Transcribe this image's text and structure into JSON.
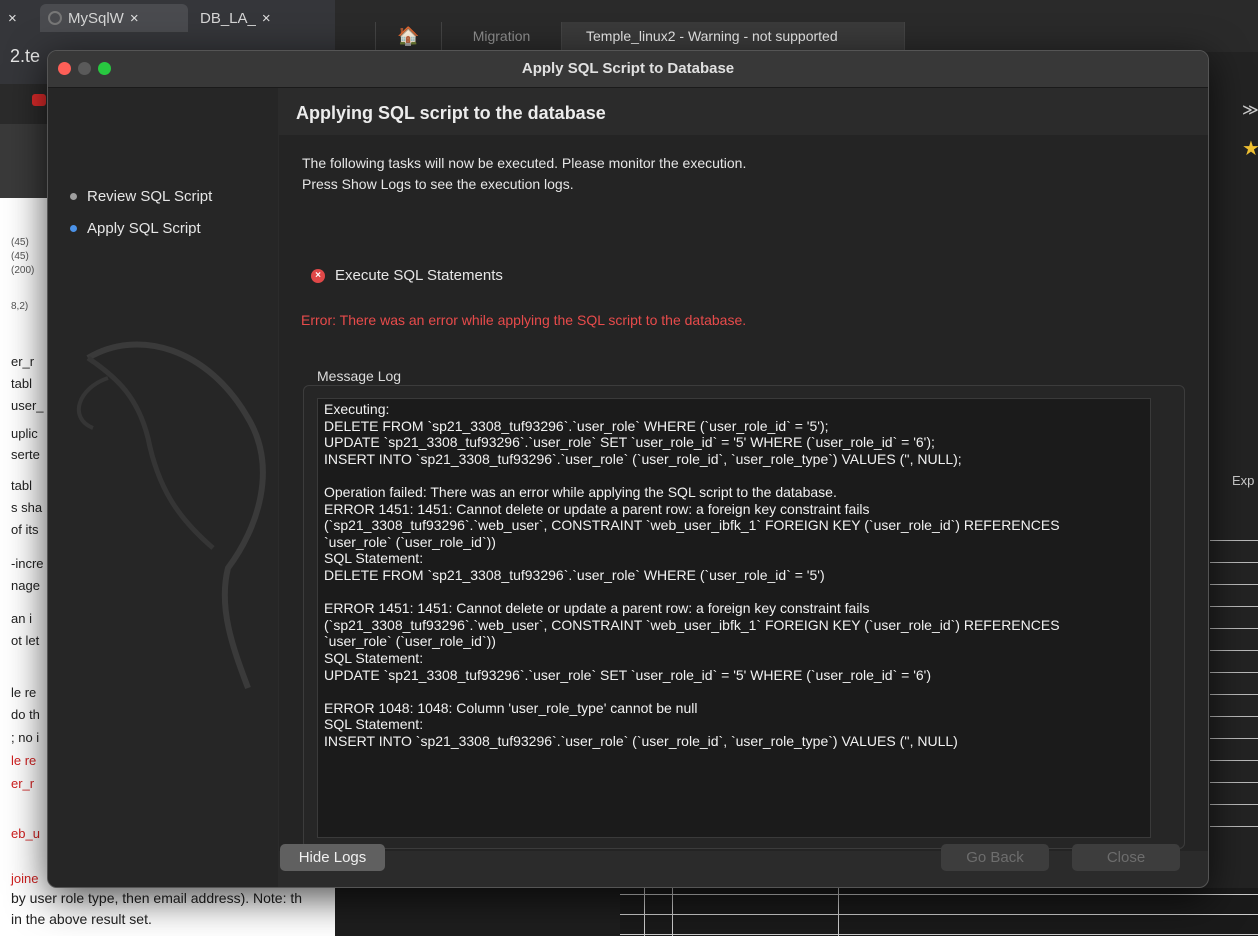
{
  "browser": {
    "tabs": [
      {
        "label": "",
        "close": "×"
      },
      {
        "label": "MySqlW",
        "close": "×"
      },
      {
        "label": "DB_LA_",
        "close": "×"
      }
    ],
    "address_fragment": "2.te"
  },
  "document": {
    "col_types": [
      "(45)",
      "(45)",
      "(200)",
      "8,2)"
    ],
    "lines": [
      {
        "text": "er_r",
        "red": false
      },
      {
        "text": " tabl",
        "red": false
      },
      {
        "text": "user_",
        "red": false
      },
      {
        "text": "uplic",
        "red": false
      },
      {
        "text": "serte",
        "red": false
      },
      {
        "text": " tabl",
        "red": false
      },
      {
        "text": "s sha",
        "red": false
      },
      {
        "text": "of its",
        "red": false
      },
      {
        "text": "-incre",
        "red": false
      },
      {
        "text": "nage",
        "red": false
      },
      {
        "text": " an i",
        "red": false
      },
      {
        "text": "ot let",
        "red": false
      },
      {
        "text": "le re",
        "red": false
      },
      {
        "text": "do th",
        "red": false
      },
      {
        "text": "; no i",
        "red": false
      },
      {
        "text": "le re",
        "red": true
      },
      {
        "text": "er_r",
        "red": true
      },
      {
        "text": "eb_u",
        "red": true
      },
      {
        "text": "joine",
        "red": true
      }
    ],
    "bottom_lines": [
      "by user role type, then email address).  Note: th",
      " in the above result set."
    ]
  },
  "workbench": {
    "tabs": [
      {
        "label": "🏠"
      },
      {
        "label": "Migration"
      },
      {
        "label": "Temple_linux2 - Warning - not supported"
      }
    ],
    "overflow": "≫",
    "star": "★",
    "export_fragment": "Exp"
  },
  "dialog": {
    "title": "Apply SQL Script to Database",
    "steps": [
      {
        "label": "Review SQL Script",
        "current": false
      },
      {
        "label": "Apply SQL Script",
        "current": true
      }
    ],
    "heading": "Applying SQL script to the database",
    "description": [
      "The following tasks will now be executed. Please monitor the execution.",
      "Press Show Logs to see the execution logs."
    ],
    "task": {
      "label": "Execute SQL Statements",
      "icon": "×",
      "status": "error"
    },
    "error_message": "Error: There was an error while applying the SQL script to the database.",
    "log_label": "Message Log",
    "log_lines": [
      "Executing:",
      "DELETE FROM `sp21_3308_tuf93296`.`user_role` WHERE (`user_role_id` = '5');",
      "UPDATE `sp21_3308_tuf93296`.`user_role` SET `user_role_id` = '5' WHERE (`user_role_id` = '6');",
      "INSERT INTO `sp21_3308_tuf93296`.`user_role` (`user_role_id`, `user_role_type`) VALUES ('', NULL);",
      "",
      "Operation failed: There was an error while applying the SQL script to the database.",
      "ERROR 1451: 1451: Cannot delete or update a parent row: a foreign key constraint fails",
      "(`sp21_3308_tuf93296`.`web_user`, CONSTRAINT `web_user_ibfk_1` FOREIGN KEY (`user_role_id`) REFERENCES",
      "`user_role` (`user_role_id`))",
      "SQL Statement:",
      "DELETE FROM `sp21_3308_tuf93296`.`user_role` WHERE (`user_role_id` = '5')",
      "",
      "ERROR 1451: 1451: Cannot delete or update a parent row: a foreign key constraint fails",
      "(`sp21_3308_tuf93296`.`web_user`, CONSTRAINT `web_user_ibfk_1` FOREIGN KEY (`user_role_id`) REFERENCES",
      "`user_role` (`user_role_id`))",
      "SQL Statement:",
      "UPDATE `sp21_3308_tuf93296`.`user_role` SET `user_role_id` = '5' WHERE (`user_role_id` = '6')",
      "",
      "ERROR 1048: 1048: Column 'user_role_type' cannot be null",
      "SQL Statement:",
      "INSERT INTO `sp21_3308_tuf93296`.`user_role` (`user_role_id`, `user_role_type`) VALUES ('', NULL)"
    ],
    "buttons": {
      "hide_logs": "Hide Logs",
      "go_back": "Go Back",
      "close": "Close"
    }
  },
  "colors": {
    "error": "#e84b4b",
    "current_step": "#4b92e8",
    "traffic_red": "#fe5f57",
    "traffic_green": "#28c840"
  }
}
